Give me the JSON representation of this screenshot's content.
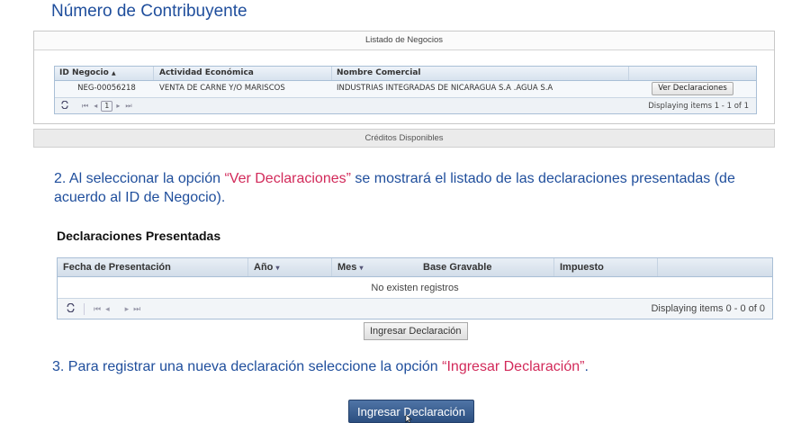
{
  "page": {
    "title": "Número de Contribuyente"
  },
  "negocios": {
    "panel_title": "Listado de Negocios",
    "columns": [
      "ID Negocio",
      "Actividad Económica",
      "Nombre Comercial"
    ],
    "sort_indicator": "▲",
    "rows": [
      {
        "id": "NEG-00056218",
        "actividad": "VENTA DE CARNE Y/O MARISCOS",
        "nombre": "INDUSTRIAS INTEGRADAS DE NICARAGUA S.A .AGUA S.A",
        "action": "Ver Declaraciones"
      }
    ],
    "pager": {
      "page": "1",
      "display": "Displaying items 1 - 1 of 1"
    }
  },
  "creditos": {
    "panel_title": "Créditos Disponibles"
  },
  "step2": {
    "prefix": "2. Al seleccionar la opción ",
    "highlight": "“Ver Declaraciones”",
    "suffix": " se mostrará el listado de las declaraciones presentadas (de acuerdo al ID de Negocio)."
  },
  "declaraciones": {
    "title": "Declaraciones Presentadas",
    "columns": [
      "Fecha de Presentación",
      "Año",
      "Mes",
      "Base Gravable",
      "Impuesto"
    ],
    "empty": "No existen registros",
    "pager": {
      "display": "Displaying items 0 - 0 of 0"
    },
    "button": "Ingresar Declaración"
  },
  "step3": {
    "prefix": "3. Para registrar una nueva declaración seleccione la opción ",
    "highlight": "“Ingresar Declaración”",
    "suffix": "."
  },
  "main_button": "Ingresar Declaración",
  "icons": {
    "refresh": "refresh-icon",
    "first": "first-page-icon",
    "prev": "prev-page-icon",
    "next": "next-page-icon",
    "last": "last-page-icon",
    "sort": "sort-asc-icon",
    "dropdown": "dropdown-arrow-icon",
    "cursor": "mouse-pointer-icon"
  },
  "colors": {
    "heading_blue": "#1f4e9c",
    "highlight_pink": "#d22a5a",
    "button_blue": "#3a5f92"
  }
}
